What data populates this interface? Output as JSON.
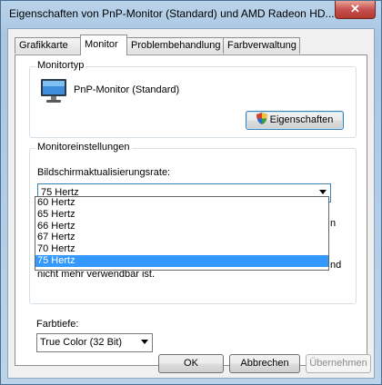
{
  "window": {
    "title": "Eigenschaften von PnP-Monitor (Standard) und AMD Radeon HD...",
    "close_glyph": "✕"
  },
  "tabs": [
    {
      "label": "Grafikkarte",
      "active": false
    },
    {
      "label": "Monitor",
      "active": true
    },
    {
      "label": "Problembehandlung",
      "active": false
    },
    {
      "label": "Farbverwaltung",
      "active": false
    }
  ],
  "monitor_type": {
    "group_label": "Monitortyp",
    "monitor_name": "PnP-Monitor (Standard)",
    "properties_button": "Eigenschaften"
  },
  "monitor_settings": {
    "group_label": "Monitoreinstellungen",
    "refresh_label": "Bildschirmaktualisierungsrate:",
    "refresh_value": "75 Hertz",
    "options": [
      "60 Hertz",
      "65 Hertz",
      "66 Hertz",
      "67 Hertz",
      "70 Hertz",
      "75 Hertz"
    ],
    "selected_option": "75 Hertz",
    "behind_text_1": "n",
    "behind_text_2": "nd",
    "behind_text_3": "nicht mehr verwendbar ist."
  },
  "color_depth": {
    "label": "Farbtiefe:",
    "value": "True Color (32 Bit)"
  },
  "buttons": {
    "ok": "OK",
    "cancel": "Abbrechen",
    "apply": "Übernehmen"
  },
  "colors": {
    "selection": "#3399ff",
    "title_bar": "#b9d3ea",
    "close_button": "#c75050"
  }
}
